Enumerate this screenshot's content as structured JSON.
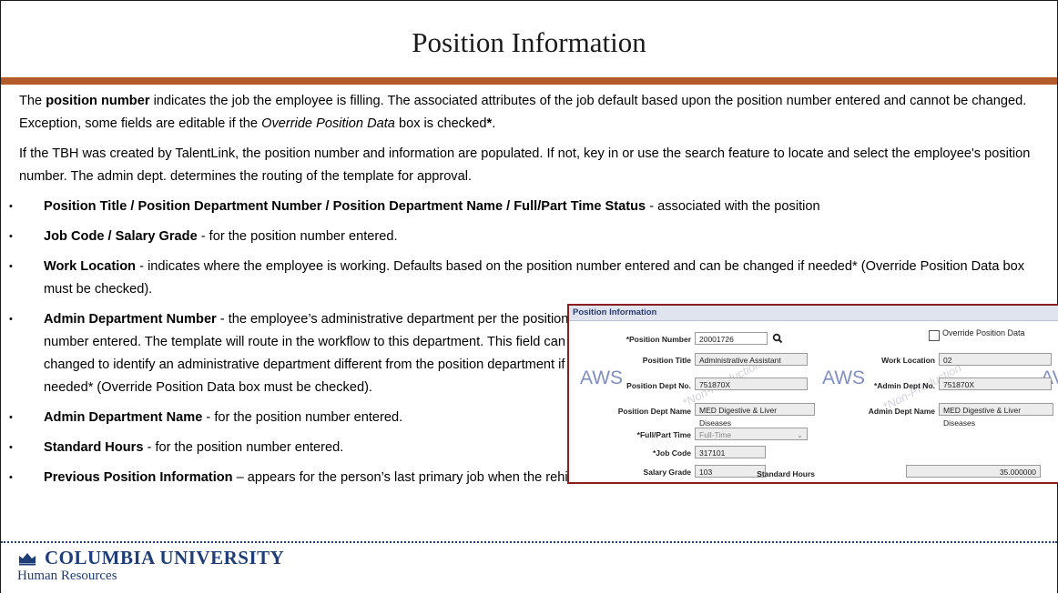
{
  "title": "Position Information",
  "intro1": {
    "before": "The ",
    "bold": "position number",
    "middle": " indicates the job the employee is filling. The associated attributes of the job default based upon the position number entered and cannot be changed. Exception, some fields are editable if the ",
    "italic": "Override Position Data",
    "after": " box is checked",
    "star": "*",
    "end": "."
  },
  "intro2": "If the TBH was created by TalentLink, the position number and information are populated. If not, key in or use the search feature to locate and select the employee's position number. The admin dept. determines the routing of the template for approval.",
  "bullets": [
    {
      "bold": "Position Title / Position Department Number / Position Department Name / Full/Part Time Status",
      "text": "  - associated with the position"
    },
    {
      "bold": "Job Code /  Salary Grade",
      "text": " - for the position number entered."
    },
    {
      "bold": "Work Location",
      "text": " - indicates where the employee is working. Defaults based on the position number entered and can be changed if needed* (Override Position Data box must be checked)."
    },
    {
      "bold": "Admin Department Number",
      "text": " - the employee’s administrative department per the position number entered. The template will route in the workflow to this department. This field can be changed to identify an administrative department different from the position department if needed* (Override Position Data box must be checked)."
    },
    {
      "bold": "Admin Department Name",
      "text": " - for the position number entered."
    },
    {
      "bold": "Standard Hours",
      "text": " - for the position number entered."
    },
    {
      "bold": "Previous Position Information",
      "text": " – appears for the person’s last primary job when the rehire template is used, cannot be changed."
    }
  ],
  "logo": {
    "name": "COLUMBIA UNIVERSITY",
    "dept": "Human Resources"
  },
  "colors": {
    "rule": "#b35b2a",
    "brand": "#1f3e78",
    "frame": "#8b1e1e"
  },
  "screenshot": {
    "header": "Position Information",
    "override_label": "Override Position Data",
    "position_number_label": "*Position Number",
    "position_number_value": "20001726",
    "position_title_label": "Position Title",
    "position_title_value": "Administrative Assistant",
    "position_dept_no_label": "Position Dept No.",
    "position_dept_no_value": "751870X",
    "position_dept_name_label": "Position Dept Name",
    "position_dept_name_value": "MED Digestive & Liver Diseases",
    "full_part_label": "*Full/Part Time",
    "full_part_value": "Full-Time",
    "job_code_label": "*Job Code",
    "job_code_value": "317101",
    "salary_grade_label": "Salary Grade",
    "salary_grade_value": "103",
    "work_location_label": "Work Location",
    "work_location_value": "02",
    "admin_dept_no_label": "*Admin Dept No.",
    "admin_dept_no_value": "751870X",
    "admin_dept_name_label": "Admin Dept Name",
    "admin_dept_name_value": "MED Digestive & Liver Diseases",
    "standard_hours_label": "Standard Hours",
    "standard_hours_value": "35.000000",
    "watermark": "AWS",
    "watermark_partial": "AV",
    "nonprod": "*Non-Production"
  }
}
